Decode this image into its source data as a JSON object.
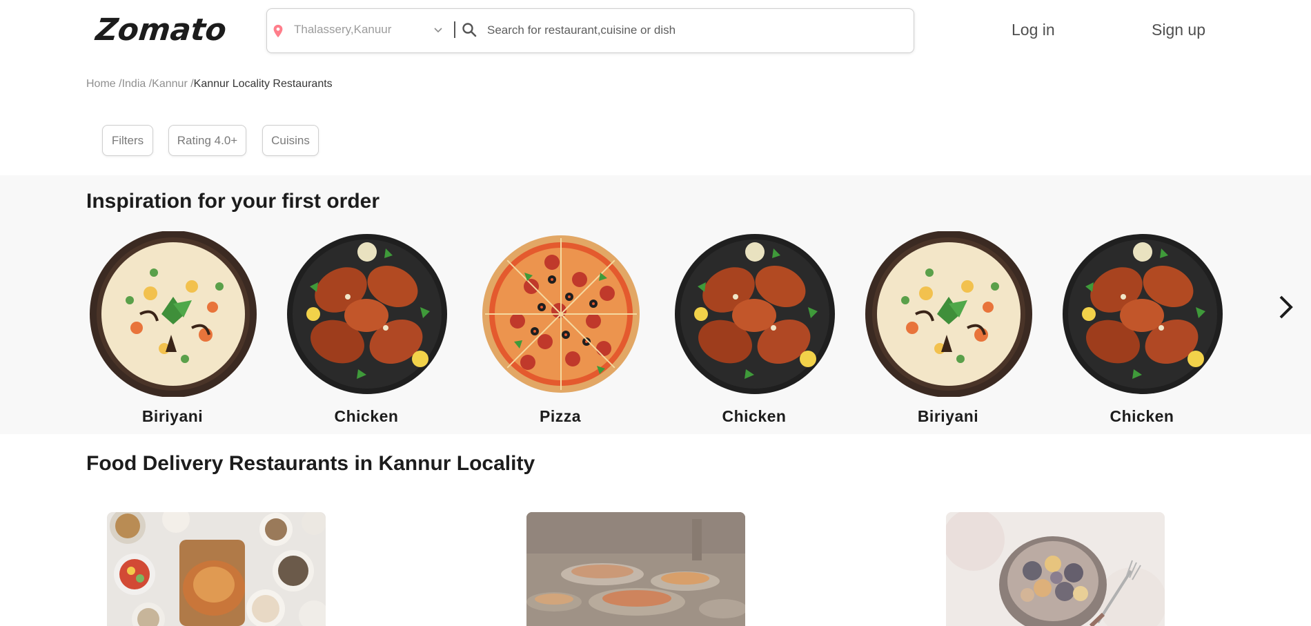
{
  "brand": {
    "logo": "Zomato"
  },
  "header": {
    "location_value": "Thalassery,Kanuur",
    "search_placeholder": "Search for restaurant,cuisine or dish",
    "login_label": "Log in",
    "signup_label": "Sign up"
  },
  "breadcrumb": {
    "items": [
      "Home /",
      "India /",
      "Kannur /"
    ],
    "current": "Kannur Locality Restaurants"
  },
  "filters": {
    "filters_label": "Filters",
    "rating_label": "Rating 4.0+",
    "cuisins_label": "Cuisins"
  },
  "inspiration": {
    "title": "Inspiration for your first order",
    "dishes": [
      {
        "label": "Biriyani",
        "kind": "biriyani"
      },
      {
        "label": "Chicken",
        "kind": "chicken"
      },
      {
        "label": "Pizza",
        "kind": "pizza"
      },
      {
        "label": "Chicken",
        "kind": "chicken"
      },
      {
        "label": "Biriyani",
        "kind": "biriyani"
      },
      {
        "label": "Chicken",
        "kind": "chicken"
      }
    ]
  },
  "restaurants": {
    "title": "Food Delivery Restaurants in Kannur Locality"
  },
  "colors": {
    "accent": "#ef4f5f",
    "text": "#1c1c1c",
    "section_bg": "#f8f8f8"
  }
}
